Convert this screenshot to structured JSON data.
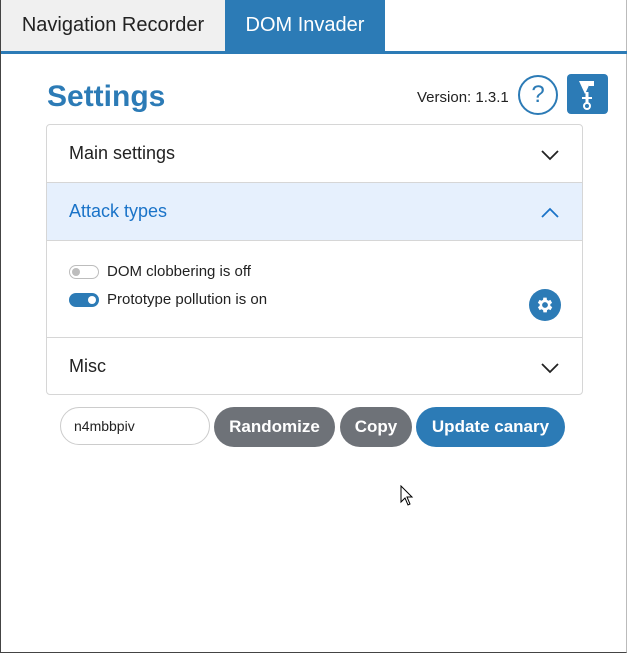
{
  "tabs": [
    {
      "label": "Navigation Recorder",
      "active": false
    },
    {
      "label": "DOM Invader",
      "active": true
    }
  ],
  "header": {
    "title": "Settings",
    "version": "Version: 1.3.1",
    "help_icon": "?"
  },
  "accordion": {
    "sections": [
      {
        "label": "Main settings",
        "expanded": false
      },
      {
        "label": "Attack types",
        "expanded": true
      },
      {
        "label": "Misc",
        "expanded": false
      }
    ],
    "attack_types": {
      "dom_clobbering": {
        "label": "DOM clobbering is off",
        "enabled": false
      },
      "prototype_pollution": {
        "label": "Prototype pollution is on",
        "enabled": true
      }
    }
  },
  "canary": {
    "value": "n4mbbpiv",
    "randomize_label": "Randomize",
    "copy_label": "Copy",
    "update_label": "Update canary"
  },
  "colors": {
    "accent": "#2c7bb6",
    "secondary_button": "#6e7278",
    "expanded_header_bg": "#e6f0fd"
  },
  "icons": {
    "help": "question-icon",
    "logo": "dom-invader-logo",
    "gear": "gear-icon",
    "chevron_down": "chevron-down-icon",
    "chevron_up": "chevron-up-icon"
  }
}
